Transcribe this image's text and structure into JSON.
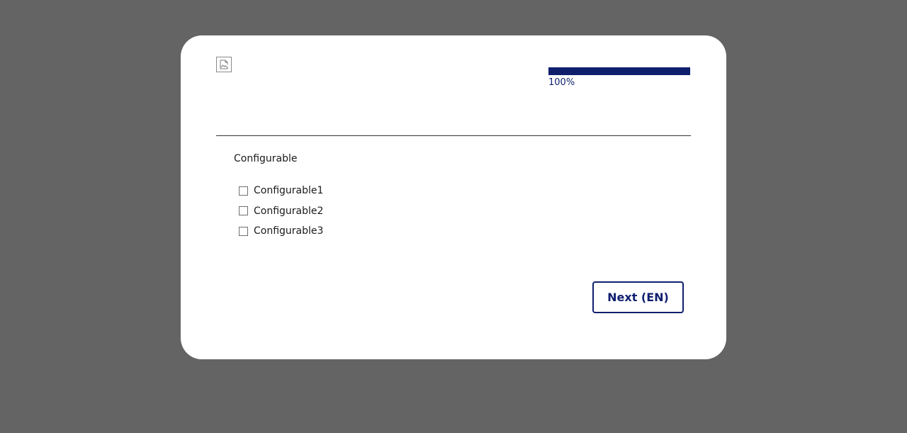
{
  "header": {
    "logo_icon": "broken-image-icon"
  },
  "progress": {
    "percent": 100,
    "label": "100%",
    "color": "#0f1f6e"
  },
  "question": {
    "title": "Configurable",
    "options": [
      {
        "label": "Configurable1",
        "checked": false
      },
      {
        "label": "Configurable2",
        "checked": false
      },
      {
        "label": "Configurable3",
        "checked": false
      }
    ]
  },
  "footer": {
    "next_label": "Next (EN)"
  },
  "colors": {
    "background": "#646464",
    "card": "#ffffff",
    "accent": "#0f1f6e"
  }
}
